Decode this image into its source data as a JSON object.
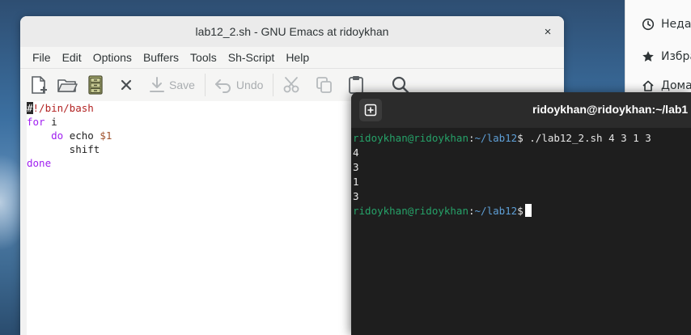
{
  "emacs": {
    "title": "lab12_2.sh - GNU Emacs at ridoykhan",
    "close": "×",
    "menu": [
      "File",
      "Edit",
      "Options",
      "Buffers",
      "Tools",
      "Sh-Script",
      "Help"
    ],
    "toolbar": {
      "save_label": "Save",
      "undo_label": "Undo"
    },
    "code": {
      "line1_hash": "#",
      "line1_rest": "!/bin/bash",
      "line2_kw": "for",
      "line2_rest": " i",
      "line3_indent": "    ",
      "line3_kw": "do",
      "line3_mid": " echo ",
      "line3_var": "$1",
      "line4": "       shift",
      "line5_kw": "done"
    }
  },
  "terminal": {
    "title": "ridoykhan@ridoykhan:~/lab1",
    "prompt_user": "ridoykhan@ridoykhan",
    "prompt_sep": ":",
    "prompt_path": "~/lab12",
    "prompt_dollar": "$",
    "command": " ./lab12_2.sh 4 3 1 3",
    "output": [
      "4",
      "3",
      "1",
      "3"
    ]
  },
  "files": {
    "items": [
      {
        "label": "Недав",
        "icon": "clock-icon"
      },
      {
        "label": "Избра",
        "icon": "star-icon"
      },
      {
        "label": "Дома",
        "icon": "home-icon"
      }
    ]
  }
}
